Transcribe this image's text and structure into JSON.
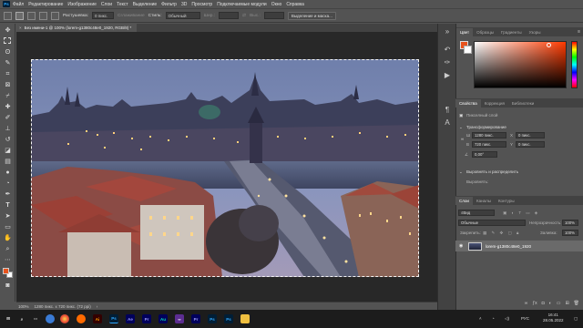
{
  "app": {
    "logo": "Ps"
  },
  "menu": [
    "Файл",
    "Редактирование",
    "Изображение",
    "Слои",
    "Текст",
    "Выделение",
    "Фильтр",
    "3D",
    "Просмотр",
    "Подключаемые модули",
    "Окно",
    "Справка"
  ],
  "options": {
    "feather_label": "Растушевка:",
    "feather_value": "0 пикс.",
    "antialias_label": "Сглаживание",
    "style_label": "Стиль:",
    "style_value": "Обычный",
    "width_label": "Шир.:",
    "height_label": "Выс.:",
    "select_mask_button": "Выделение и маска..."
  },
  "document": {
    "tab_title": "Без имени-1 @ 100% (lorem-g1380c48e0_1920, RGB/8) *",
    "close_glyph": "×"
  },
  "status": {
    "zoom": "100%",
    "info": "1280 пикс. x 720 пикс. (72 ppi)",
    "arrow": "›"
  },
  "toolbar_icons": [
    "move-icon",
    "marquee-icon",
    "lasso-icon",
    "quick-select-icon",
    "crop-icon",
    "frame-icon",
    "eyedropper-icon",
    "healing-icon",
    "brush-icon",
    "stamp-icon",
    "history-brush-icon",
    "eraser-icon",
    "gradient-icon",
    "blur-icon",
    "dodge-icon",
    "pen-icon",
    "type-icon",
    "path-select-icon",
    "shape-icon",
    "hand-icon",
    "zoom-icon",
    "more-icon"
  ],
  "color_panel": {
    "tabs": [
      "Цвет",
      "Образцы",
      "Градиенты",
      "Узоры"
    ],
    "foreground": "#e8541e",
    "background": "#ffffff"
  },
  "properties_panel": {
    "tabs": [
      "Свойства",
      "Коррекция",
      "Библиотеки"
    ],
    "layer_type": "Пикселный слой",
    "transform_label": "Трансформирование",
    "w_label": "Ш",
    "w_value": "1280 пикс.",
    "h_label": "В",
    "h_value": "720 пикс.",
    "x_label": "X",
    "x_value": "0 пикс.",
    "y_label": "Y",
    "y_value": "0 пикс.",
    "angle_value": "0,00°",
    "align_label": "Выровнять и распределить",
    "align_sub": "Выровнять:"
  },
  "layers_panel": {
    "tabs": [
      "Слои",
      "Каналы",
      "Контуры"
    ],
    "filter_label": "Вид",
    "blend_mode": "Обычные",
    "opacity_label": "Непрозрачность:",
    "opacity_value": "100%",
    "lock_label": "Закрепить:",
    "fill_label": "Заливка:",
    "fill_value": "100%",
    "layer_name": "lorem-g1380c48e0_1920"
  },
  "taskbar": {
    "apps": [
      "Ps",
      "Ae",
      "Pr",
      "Ai",
      "Ps",
      "Ae",
      "Pr",
      "Au",
      "VS",
      "Pr",
      "Ps",
      "Ps",
      "Files"
    ],
    "lang": "РУС",
    "time": "16:41",
    "date": "28.05.2022"
  },
  "photo_alt": "Prague Charles Bridge at dusk"
}
